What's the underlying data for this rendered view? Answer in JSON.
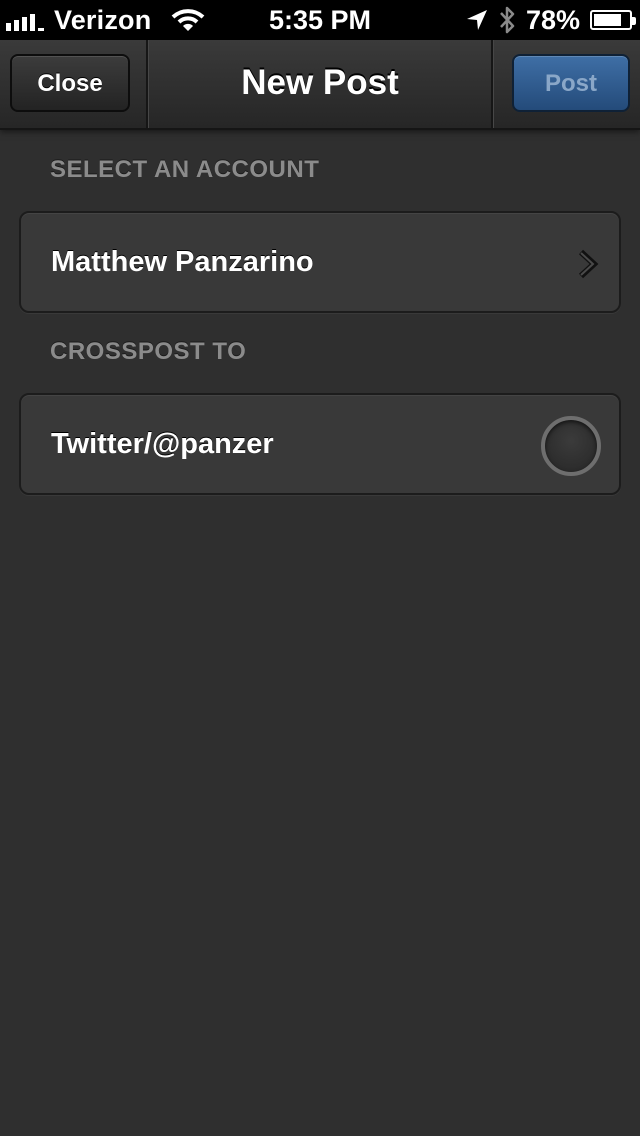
{
  "status_bar": {
    "carrier": "Verizon",
    "time": "5:35 PM",
    "battery_percent": "78%",
    "battery_level": 0.78,
    "icons": [
      "signal-icon",
      "wifi-icon",
      "location-icon",
      "bluetooth-icon",
      "battery-icon"
    ]
  },
  "nav": {
    "title": "New Post",
    "close_label": "Close",
    "post_label": "Post"
  },
  "sections": {
    "account_header": "SELECT AN ACCOUNT",
    "account_name": "Matthew Panzarino",
    "crosspost_header": "CROSSPOST TO",
    "crosspost_target": "Twitter/@panzer",
    "crosspost_selected": false
  },
  "colors": {
    "background": "#2f2f2f",
    "post_button": "#2f5d92",
    "header_text": "#8b8b8b"
  }
}
